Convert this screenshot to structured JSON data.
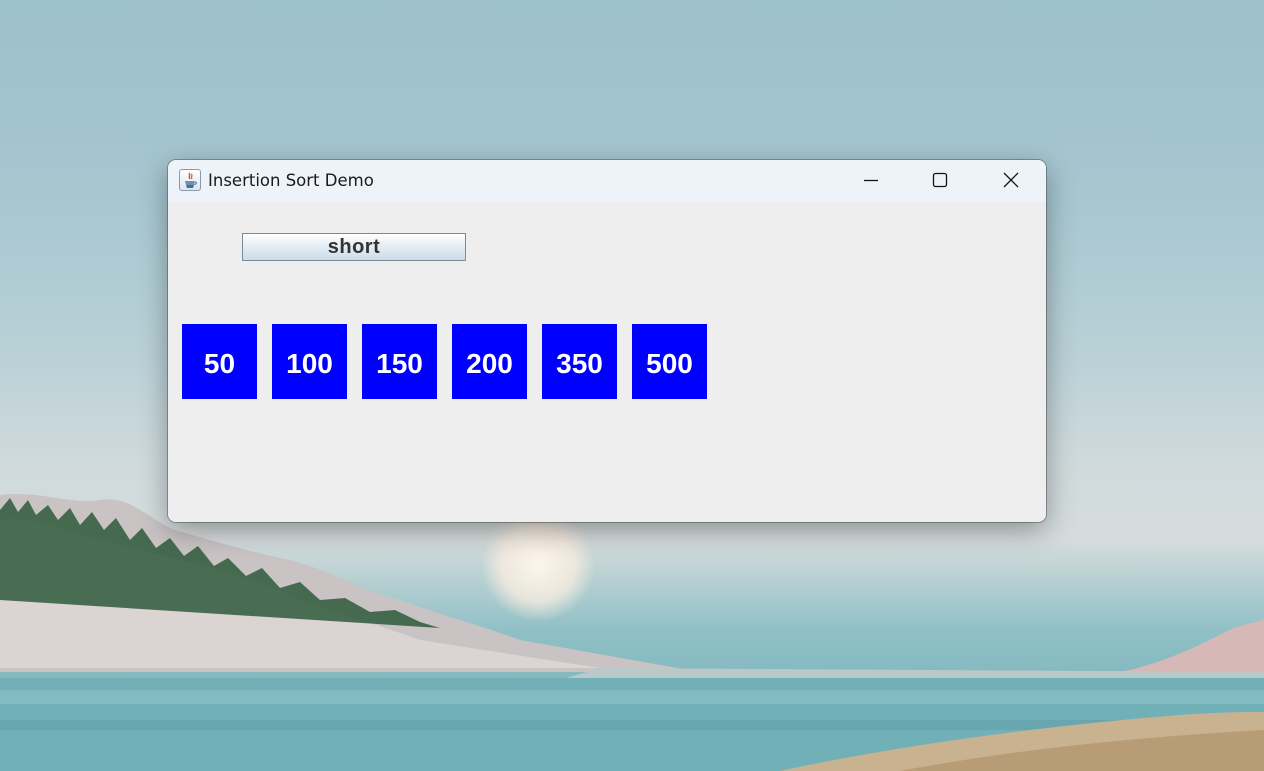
{
  "window": {
    "title": "Insertion Sort Demo",
    "minimize_icon": "minimize-icon",
    "maximize_icon": "maximize-icon",
    "close_icon": "close-icon",
    "app_icon": "java-coffee-cup-icon"
  },
  "controls": {
    "sort_button_label": "short"
  },
  "array": {
    "box_color": "#0000ff",
    "text_color": "#ffffff",
    "values": [
      "50",
      "100",
      "150",
      "200",
      "350",
      "500"
    ]
  }
}
